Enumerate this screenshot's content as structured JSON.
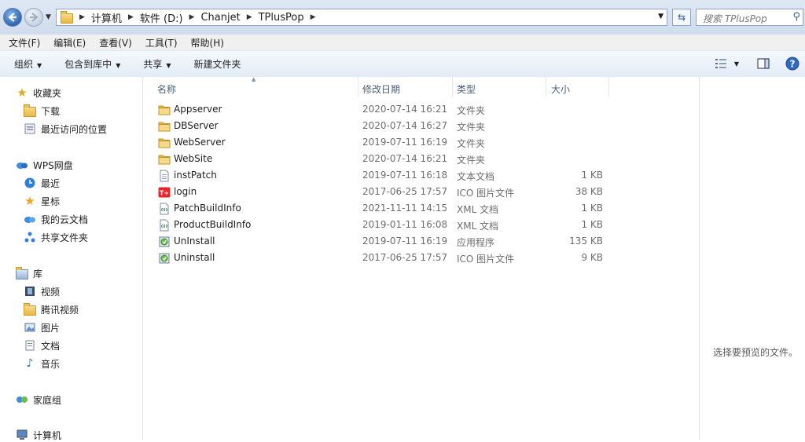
{
  "address": {
    "crumbs": [
      "计算机",
      "软件 (D:)",
      "Chanjet",
      "TPlusPop"
    ],
    "search_placeholder": "搜索 TPlusPop",
    "back_icon": "back-arrow-icon",
    "forward_icon": "forward-arrow-icon",
    "refresh_icon": "refresh-icon",
    "search_icon": "search-icon"
  },
  "menu": [
    "文件(F)",
    "编辑(E)",
    "查看(V)",
    "工具(T)",
    "帮助(H)"
  ],
  "toolbar": {
    "organize": "组织",
    "include_library": "包含到库中",
    "share": "共享",
    "new_folder": "新建文件夹"
  },
  "nav": {
    "favorites": {
      "label": "收藏夹",
      "items": [
        "下载",
        "最近访问的位置"
      ]
    },
    "wps": {
      "label": "WPS网盘",
      "items": [
        "最近",
        "星标",
        "我的云文档",
        "共享文件夹"
      ]
    },
    "library": {
      "label": "库",
      "items": [
        "视频",
        "腾讯视频",
        "图片",
        "文档",
        "音乐"
      ]
    },
    "homegroup": "家庭组",
    "computer": "计算机"
  },
  "columns": {
    "name": "名称",
    "modified": "修改日期",
    "type": "类型",
    "size": "大小"
  },
  "files": [
    {
      "name": "Appserver",
      "modified": "2020-07-14 16:21",
      "type": "文件夹",
      "size": "",
      "icon": "folder-icon"
    },
    {
      "name": "DBServer",
      "modified": "2020-07-14 16:27",
      "type": "文件夹",
      "size": "",
      "icon": "folder-icon"
    },
    {
      "name": "WebServer",
      "modified": "2019-07-11 16:19",
      "type": "文件夹",
      "size": "",
      "icon": "folder-icon"
    },
    {
      "name": "WebSite",
      "modified": "2020-07-14 16:21",
      "type": "文件夹",
      "size": "",
      "icon": "folder-icon"
    },
    {
      "name": "instPatch",
      "modified": "2019-07-11 16:18",
      "type": "文本文档",
      "size": "1 KB",
      "icon": "text-document-icon"
    },
    {
      "name": "login",
      "modified": "2017-06-25 17:57",
      "type": "ICO 图片文件",
      "size": "38 KB",
      "icon": "tplus-logo-icon"
    },
    {
      "name": "PatchBuildInfo",
      "modified": "2021-11-11 14:15",
      "type": "XML 文档",
      "size": "1 KB",
      "icon": "xml-document-icon"
    },
    {
      "name": "ProductBuildInfo",
      "modified": "2019-01-11 16:08",
      "type": "XML 文档",
      "size": "1 KB",
      "icon": "xml-document-icon"
    },
    {
      "name": "UnInstall",
      "modified": "2019-07-11 16:19",
      "type": "应用程序",
      "size": "135 KB",
      "icon": "uninstall-app-icon"
    },
    {
      "name": "Uninstall",
      "modified": "2017-06-25 17:57",
      "type": "ICO 图片文件",
      "size": "9 KB",
      "icon": "uninstall-app-icon"
    }
  ],
  "preview_message": "选择要预览的文件。"
}
